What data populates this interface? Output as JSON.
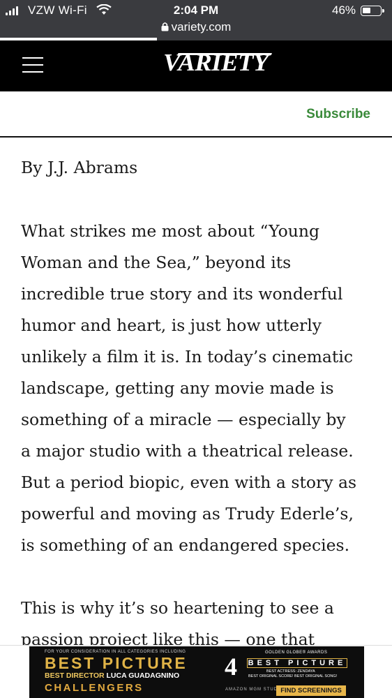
{
  "status_bar": {
    "carrier": "VZW Wi-Fi",
    "time": "2:04 PM",
    "battery_percent": "46%",
    "battery_level": 0.46,
    "url": "variety.com",
    "load_progress": 0.4
  },
  "header": {
    "logo_text": "VARIETY",
    "subscribe_label": "Subscribe",
    "subscribe_color": "#3a8a3a"
  },
  "article": {
    "byline": "By J.J. Abrams",
    "para1_lines": [
      "What strikes me most about “Young",
      "Woman and the Sea,” beyond its",
      "incredible true story and its wonderful",
      "humor and heart, is just how utterly",
      "unlikely a film it is. In today’s cinematic",
      "landscape, getting any movie made is",
      "something of a miracle — especially by",
      "a major studio with a theatrical release.",
      "But a period biopic, even with a story as",
      "powerful and moving as Trudy Ederle’s,",
      "is something of an endangered species."
    ],
    "para2_lines": [
      "This is why it’s so heartening to see a",
      "passion project like this — one that"
    ]
  },
  "ad": {
    "consideration": "FOR YOUR CONSIDERATION IN ALL CATEGORIES INCLUDING",
    "best_picture": "BEST PICTURE",
    "director_prefix": "BEST DIRECTOR",
    "director_name": "LUCA GUADAGNINO",
    "film": "CHALLENGERS",
    "golden_globe": "GOLDEN GLOBE® AWARDS",
    "nominations": "4",
    "bp_right": "BEST PICTURE",
    "actress": "BEST ACTRESS: ZENDAYA",
    "score_song": "BEST ORIGINAL SCORE! BEST ORIGINAL SONG!",
    "studio": "AMAZON MGM STUDIOS",
    "find_label": "FIND SCREENINGS"
  }
}
